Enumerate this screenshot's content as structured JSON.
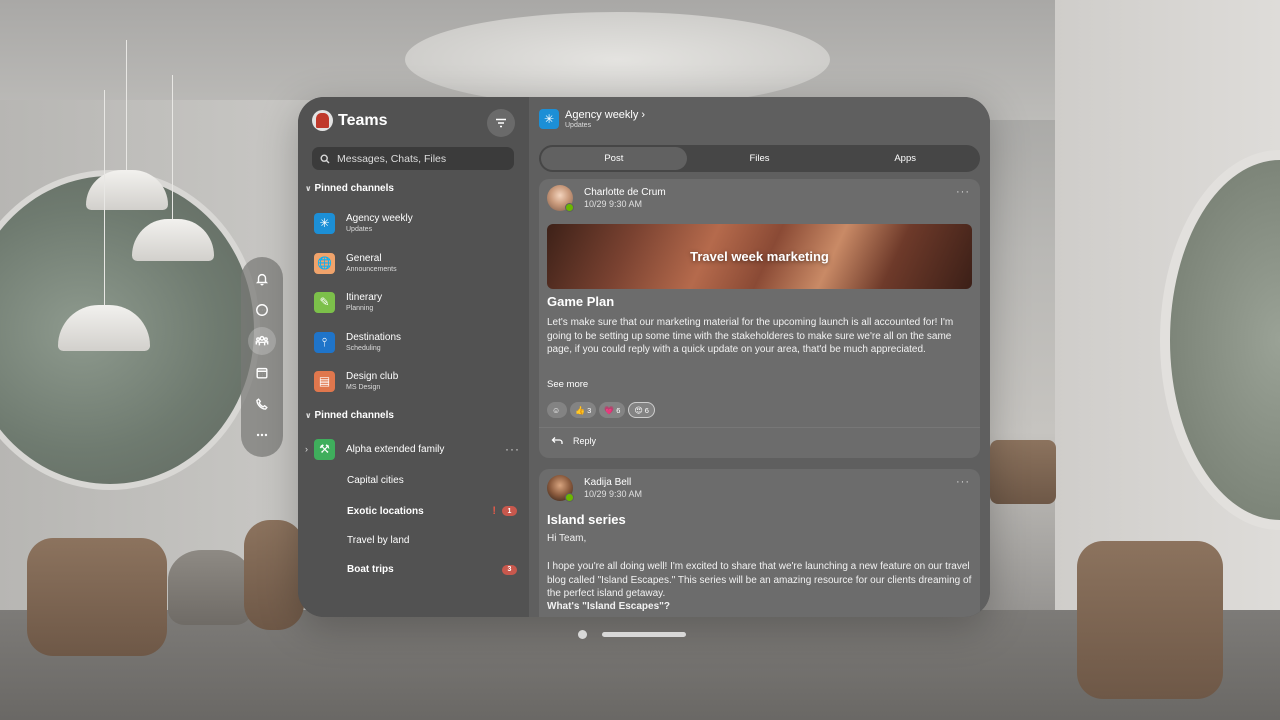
{
  "app": {
    "title": "Teams"
  },
  "search": {
    "placeholder": "Messages, Chats, Files"
  },
  "sidebar": {
    "section1_label": "Pinned channels",
    "channels": [
      {
        "name": "Agency weekly",
        "sub": "Updates",
        "icon": "snowflake-icon",
        "color": "#1c8fd6"
      },
      {
        "name": "General",
        "sub": "Announcements",
        "icon": "globe-icon",
        "color": "#f0a36b"
      },
      {
        "name": "Itinerary",
        "sub": "Planning",
        "icon": "notepad-icon",
        "color": "#7cc04a"
      },
      {
        "name": "Destinations",
        "sub": "Scheduling",
        "icon": "pin-icon",
        "color": "#1f74c9"
      },
      {
        "name": "Design club",
        "sub": "MS Design",
        "icon": "book-icon",
        "color": "#e0774d"
      }
    ],
    "section2_label": "Pinned channels",
    "team": {
      "name": "Alpha extended family",
      "more": "···",
      "icon": "tools-icon",
      "color": "#3fae5c"
    },
    "team_channels": [
      {
        "name": "Capital cities",
        "bold": false,
        "alert": "",
        "badge": ""
      },
      {
        "name": "Exotic locations",
        "bold": true,
        "alert": "!",
        "badge": "1"
      },
      {
        "name": "Travel by land",
        "bold": false,
        "alert": "",
        "badge": ""
      },
      {
        "name": "Boat trips",
        "bold": true,
        "alert": "",
        "badge": "3"
      }
    ]
  },
  "channel_header": {
    "title": "Agency weekly ›",
    "sub": "Updates"
  },
  "tabs": [
    "Post",
    "Files",
    "Apps"
  ],
  "posts": [
    {
      "author": "Charlotte de Crum",
      "time": "10/29 9:30 AM",
      "more": "···",
      "banner": "Travel week marketing",
      "title": "Game Plan",
      "body": "Let's make sure that our marketing material for the upcoming launch is all accounted for! I'm going to be setting up some time with the stakeholderes to make sure we're all on the same page, if you could reply with a quick update on your area, that'd be much appreciated.",
      "see_more": "See more",
      "reactions": [
        {
          "emoji": "☺",
          "count": ""
        },
        {
          "emoji": "👍",
          "count": "3"
        },
        {
          "emoji": "💗",
          "count": "6"
        },
        {
          "emoji": "😍",
          "count": "6"
        }
      ],
      "reply": "Reply"
    },
    {
      "author": "Kadija Bell",
      "time": "10/29 9:30 AM",
      "more": "···",
      "title": "Island series",
      "greeting": "Hi Team,",
      "body": "I hope you're all doing well! I'm excited to share that we're launching a new feature on our travel blog called \"Island Escapes.\" This series will be an amazing resource for our clients dreaming of the perfect island getaway.",
      "subhead": "What's \"Island Escapes\"?"
    }
  ],
  "colors": {
    "presence": "#6bb700",
    "badge": "#c8584d",
    "alert": "#e15a4a"
  }
}
